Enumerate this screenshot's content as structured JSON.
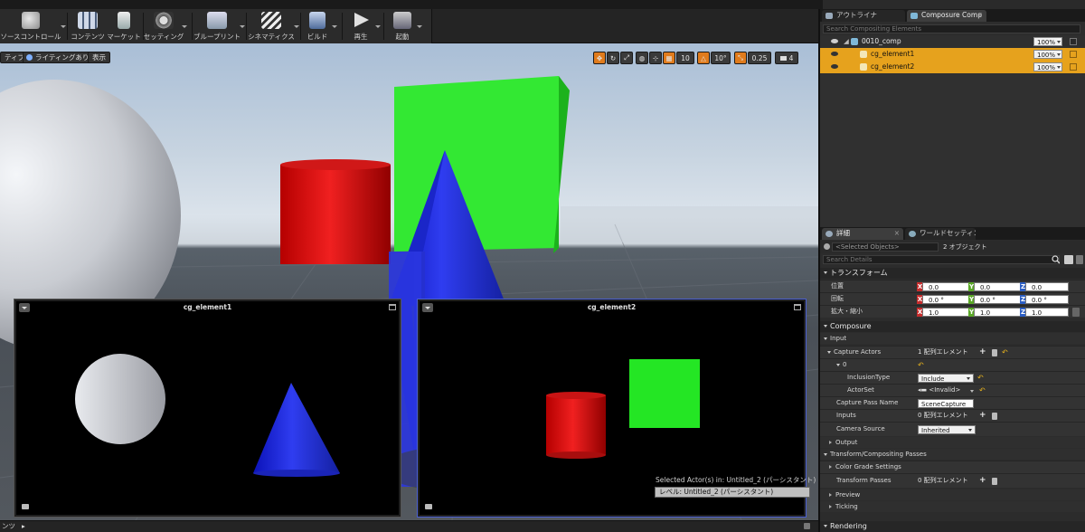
{
  "toolbar": {
    "items": [
      {
        "label": "ソースコントロール",
        "icon": "source-control-icon"
      },
      {
        "label": "コンテンツ",
        "icon": "content-icon"
      },
      {
        "label": "マーケット",
        "icon": "marketplace-icon"
      },
      {
        "label": "セッティング",
        "icon": "settings-icon"
      },
      {
        "label": "ブループリント",
        "icon": "blueprint-icon"
      },
      {
        "label": "シネマティクス",
        "icon": "cinematics-icon"
      },
      {
        "label": "ビルド",
        "icon": "build-icon"
      },
      {
        "label": "再生",
        "icon": "play-icon"
      },
      {
        "label": "起動",
        "icon": "launch-icon"
      }
    ]
  },
  "viewport": {
    "perspective_label": "ティブ",
    "lit_label": "ライティングあり",
    "show_label": "表示",
    "grid_snap": "10",
    "rotation_snap": "10°",
    "scale_snap": "0.25",
    "camera_speed": "4"
  },
  "composite_windows": [
    {
      "title": "cg_element1"
    },
    {
      "title": "cg_element2"
    }
  ],
  "status": {
    "selected_actors": "Selected Actor(s) in:  Untitled_2 (パーシスタント)",
    "level": "レベル:  Untitled_2 (パーシスタント)"
  },
  "bottombar": {
    "label": "ンツ",
    "arrow": "▸"
  },
  "panels": {
    "outliner_tab": "アウトライナ",
    "composure_tab": "Composure Comp",
    "close": "×",
    "search_placeholder": "Search Compositing Elements",
    "elements": [
      {
        "name": "0010_comp",
        "opacity": "100%",
        "selected": false
      },
      {
        "name": "cg_element1",
        "opacity": "100%",
        "selected": true
      },
      {
        "name": "cg_element2",
        "opacity": "100%",
        "selected": true
      }
    ]
  },
  "details": {
    "details_tab": "詳細",
    "world_tab": "ワールドセッティング",
    "selected_objects_placeholder": "<Selected Objects>",
    "object_count": "2 オブジェクト",
    "search_placeholder": "Search Details",
    "transform_header": "トランスフォーム",
    "location_label": "位置",
    "rotation_label": "回転",
    "scale_label": "拡大・縮小",
    "location": [
      "0.0",
      "0.0",
      "0.0"
    ],
    "rotation": [
      "0.0 °",
      "0.0 °",
      "0.0 °"
    ],
    "scale": [
      "1.0",
      "1.0",
      "1.0"
    ],
    "axes": [
      "X",
      "Y",
      "Z"
    ],
    "composure_header": "Composure",
    "input_header": "Input",
    "capture_actors_label": "Capture Actors",
    "capture_actors_value": "1 配列エレメント",
    "index_label": "0",
    "inclusion_type_label": "InclusionType",
    "inclusion_type_value": "Include",
    "actor_set_label": "ActorSet",
    "actor_set_value": "<Invalid>",
    "capture_pass_name_label": "Capture Pass Name",
    "capture_pass_name_value": "SceneCapture",
    "inputs_label": "Inputs",
    "inputs_value": "0 配列エレメント",
    "camera_source_label": "Camera Source",
    "camera_source_value": "Inherited",
    "output_header": "Output",
    "transform_passes_header": "Transform/Compositing Passes",
    "color_grade_label": "Color Grade Settings",
    "transform_passes_label": "Transform Passes",
    "transform_passes_value": "0 配列エレメント",
    "preview_header": "Preview",
    "ticking_header": "Ticking",
    "rendering_header": "Rendering"
  }
}
